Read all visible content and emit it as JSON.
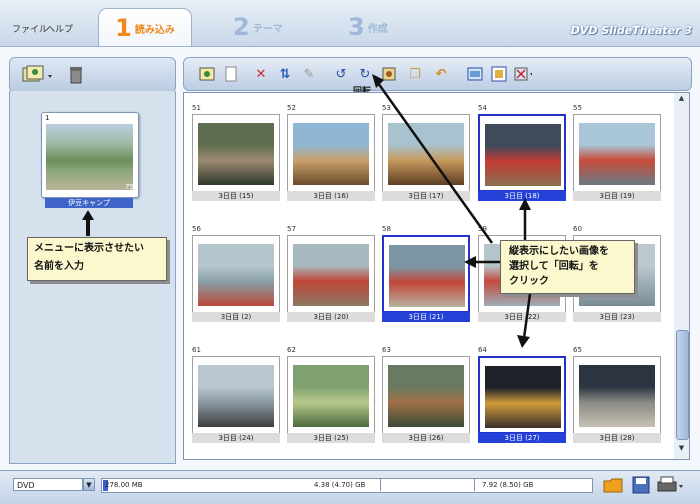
{
  "menu": {
    "file": "ファイル",
    "help": "ヘルプ"
  },
  "tabs": [
    {
      "num": "1",
      "label": "読み込み"
    },
    {
      "num": "2",
      "label": "テーマ"
    },
    {
      "num": "3",
      "label": "作成"
    }
  ],
  "app_title": "DVD SlideTheater 3",
  "album": {
    "index": "1",
    "count": "75",
    "name": "伊豆キャンプ"
  },
  "callout_left": [
    "メニューに表示させたい",
    "名前を入力"
  ],
  "callout_right": [
    "縦表示にしたい画像を",
    "選択して「回転」を",
    "クリック"
  ],
  "rotate_label": "回転",
  "thumbs": [
    {
      "idx": "51",
      "cap": "3日目 (15)",
      "sel": false,
      "colors": [
        "#5f6e4f",
        "#9d8a73",
        "#2e3a2a"
      ]
    },
    {
      "idx": "52",
      "cap": "3日目 (16)",
      "sel": false,
      "colors": [
        "#8fb7d3",
        "#c9a06b",
        "#6b4a2c"
      ]
    },
    {
      "idx": "53",
      "cap": "3日目 (17)",
      "sel": false,
      "colors": [
        "#a9c2cf",
        "#c59a5e",
        "#5e3d22"
      ]
    },
    {
      "idx": "54",
      "cap": "3日目 (18)",
      "sel": true,
      "colors": [
        "#3f4b5a",
        "#c33b33",
        "#8a6f52"
      ]
    },
    {
      "idx": "55",
      "cap": "3日目 (19)",
      "sel": false,
      "colors": [
        "#a9c6d9",
        "#c84c3a",
        "#6a7a86"
      ]
    },
    {
      "idx": "56",
      "cap": "3日目 (2)",
      "sel": false,
      "colors": [
        "#b6c6cf",
        "#8aa0aa",
        "#b84a3a"
      ]
    },
    {
      "idx": "57",
      "cap": "3日目 (20)",
      "sel": false,
      "colors": [
        "#a8b8bf",
        "#c04637",
        "#8a7a63"
      ]
    },
    {
      "idx": "58",
      "cap": "3日目 (21)",
      "sel": true,
      "colors": [
        "#7d96a6",
        "#c2473a",
        "#b8b2a0"
      ]
    },
    {
      "idx": "59",
      "cap": "3日目 (22)",
      "sel": false,
      "colors": [
        "#b4c4cb",
        "#c24b3c",
        "#9eaeb6"
      ]
    },
    {
      "idx": "60",
      "cap": "3日目 (23)",
      "sel": false,
      "colors": [
        "#bdc9d0",
        "#9fb1ba",
        "#7b8c94"
      ]
    },
    {
      "idx": "61",
      "cap": "3日目 (24)",
      "sel": false,
      "colors": [
        "#b9c7cf",
        "#8b9ba3",
        "#3d3d3d"
      ]
    },
    {
      "idx": "62",
      "cap": "3日目 (25)",
      "sel": false,
      "colors": [
        "#7fa070",
        "#b8c98c",
        "#4d6a3f"
      ]
    },
    {
      "idx": "63",
      "cap": "3日目 (26)",
      "sel": false,
      "colors": [
        "#6a7a62",
        "#a07048",
        "#3a4a34"
      ]
    },
    {
      "idx": "64",
      "cap": "3日目 (27)",
      "sel": true,
      "colors": [
        "#1c2228",
        "#d09a3a",
        "#3a3028"
      ]
    },
    {
      "idx": "65",
      "cap": "3日目 (28)",
      "sel": false,
      "colors": [
        "#2b3440",
        "#8a8a84",
        "#c7c2b5"
      ]
    }
  ],
  "status": {
    "media": "DVD",
    "cap_used": "278.00 MB",
    "cap_mid": "4.38 (4.70) GB",
    "cap_max": "7.92 (8.50) GB"
  },
  "icons": {
    "left_toolbar": [
      "add-photos-icon",
      "trash-icon"
    ],
    "right_toolbar": [
      "import-image-icon",
      "blank-page-icon",
      "delete-icon",
      "sort-icon",
      "edit-icon",
      "rotate-left-icon",
      "rotate-right-icon",
      "auto-rotate-icon",
      "copy-icon",
      "undo-icon",
      "view-icon",
      "preview-icon",
      "settings-icon"
    ],
    "status": [
      "folder-icon",
      "save-icon",
      "print-icon"
    ]
  }
}
